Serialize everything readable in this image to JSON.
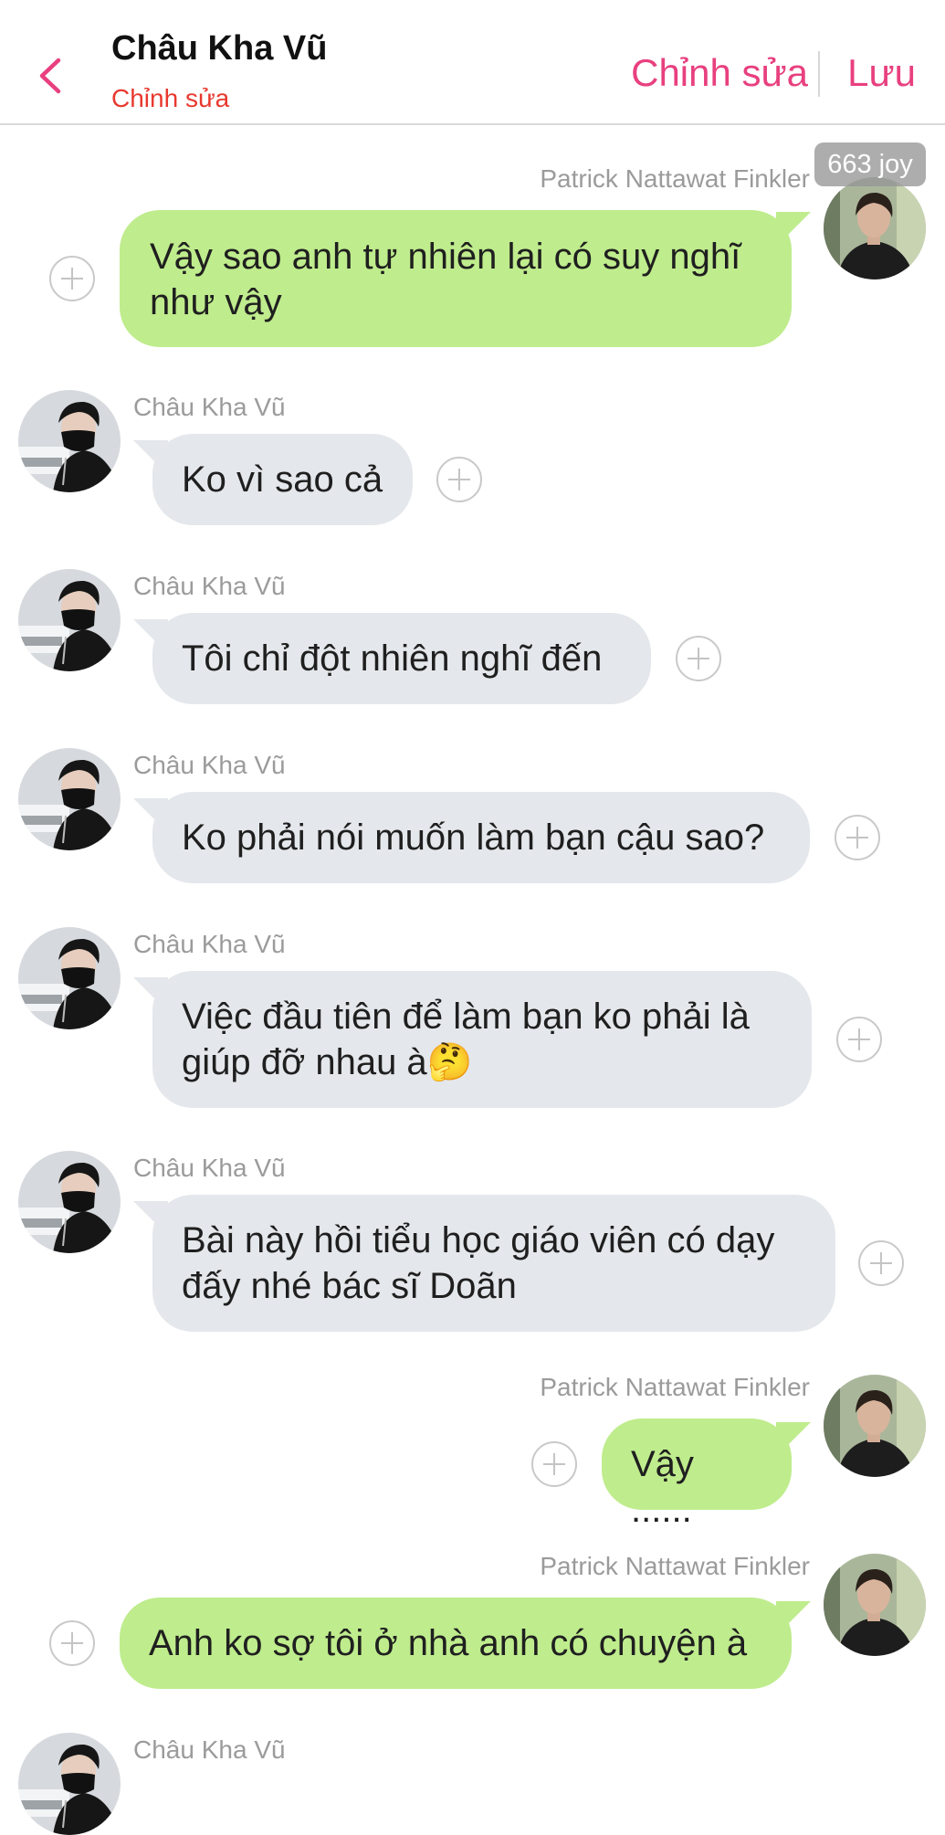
{
  "header": {
    "title": "Châu Kha Vũ",
    "subtitle": "Chỉnh sửa",
    "edit_label": "Chỉnh sửa",
    "save_label": "Lưu"
  },
  "watermark": "663 joy",
  "colors": {
    "accent": "#e8407f",
    "subtitle": "#e8392f",
    "outgoing_bubble": "#bfec8d",
    "incoming_bubble": "#e4e7eb"
  },
  "messages": [
    {
      "sender": "Patrick Nattawat Finkler",
      "direction": "outgoing",
      "lines": [
        "Vậy sao anh tự nhiên lại có suy nghĩ",
        "như vậy"
      ]
    },
    {
      "sender": "Châu Kha Vũ",
      "direction": "incoming",
      "lines": [
        "Ko vì sao cả"
      ]
    },
    {
      "sender": "Châu Kha Vũ",
      "direction": "incoming",
      "lines": [
        "Tôi chỉ đột nhiên nghĩ đến"
      ]
    },
    {
      "sender": "Châu Kha Vũ",
      "direction": "incoming",
      "lines": [
        "Ko phải nói muốn làm bạn cậu sao?"
      ]
    },
    {
      "sender": "Châu Kha Vũ",
      "direction": "incoming",
      "lines": [
        "Việc đầu tiên để làm bạn ko phải là",
        "giúp đỡ nhau à🤔"
      ]
    },
    {
      "sender": "Châu Kha Vũ",
      "direction": "incoming",
      "lines": [
        "Bài này hồi tiểu học giáo viên có dạy",
        "đấy nhé bác sĩ Doãn"
      ]
    },
    {
      "sender": "Patrick Nattawat Finkler",
      "direction": "outgoing",
      "lines": [
        "Vậy ......"
      ]
    },
    {
      "sender": "Patrick Nattawat Finkler",
      "direction": "outgoing",
      "lines": [
        "Anh ko sợ tôi ở nhà anh có chuyện à"
      ]
    },
    {
      "sender": "Châu Kha Vũ",
      "direction": "incoming",
      "lines": []
    }
  ]
}
